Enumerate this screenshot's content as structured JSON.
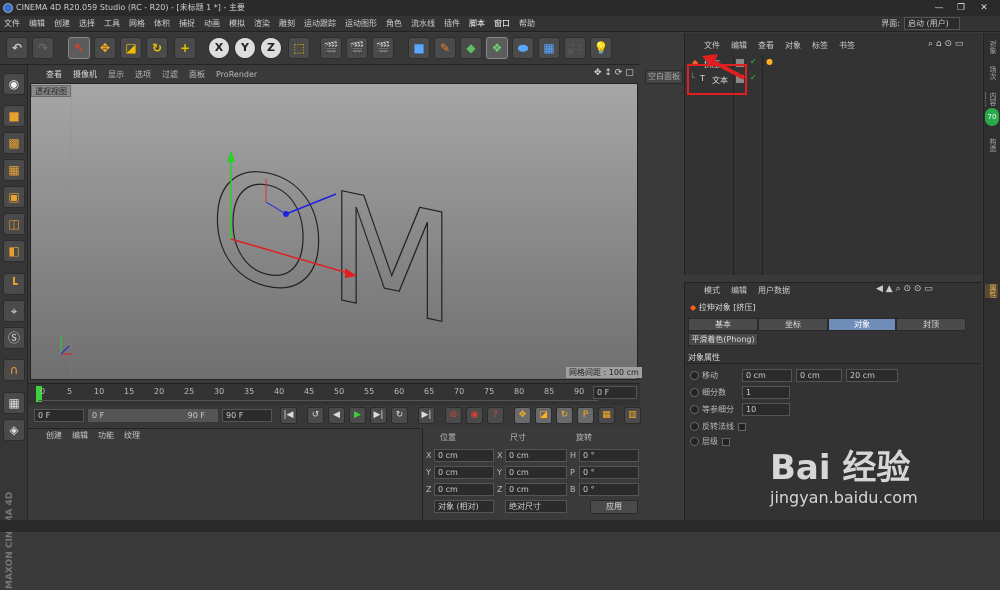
{
  "window": {
    "title": "CINEMA 4D R20.059 Studio (RC - R20) - [未标题 1 *] - 主要",
    "min": "—",
    "restore": "❐",
    "close": "✕"
  },
  "menu": [
    "文件",
    "编辑",
    "创建",
    "选择",
    "工具",
    "网格",
    "体积",
    "捕捉",
    "动画",
    "模拟",
    "渲染",
    "雕刻",
    "运动跟踪",
    "运动图形",
    "角色",
    "流水线",
    "插件",
    "脚本",
    "窗口",
    "帮助"
  ],
  "layout": {
    "label": "界面:",
    "value": "启动 (用户)"
  },
  "toolbar": {
    "undo": "↶",
    "redo": "↷",
    "select": "↖",
    "move": "✥",
    "scale": "◪",
    "rotate": "↻",
    "add": "+",
    "x": "X",
    "y": "Y",
    "z": "Z",
    "coord": "⬚"
  },
  "viewport": {
    "menu": [
      "查看",
      "摄像机",
      "显示",
      "选项",
      "过滤",
      "面板",
      "ProRender"
    ],
    "label": "透视视图",
    "grid": "网格间距 : 100 cm",
    "text3d": "OM",
    "empty_button": "空白面板"
  },
  "timeline": {
    "ticks": [
      "0",
      "5",
      "10",
      "15",
      "20",
      "25",
      "30",
      "35",
      "40",
      "45",
      "50",
      "55",
      "60",
      "65",
      "70",
      "75",
      "80",
      "85",
      "90"
    ],
    "end_field": "0 F"
  },
  "transport": {
    "start": "0 F",
    "range_start": "0 F",
    "range_end": "90 F",
    "end": "90 F"
  },
  "materials": {
    "menu": [
      "创建",
      "编辑",
      "功能",
      "纹理"
    ]
  },
  "coords": {
    "headers": [
      "位置",
      "尺寸",
      "旋转"
    ],
    "rows": [
      {
        "a": "X",
        "pos": "0 cm",
        "b": "X",
        "size": "0 cm",
        "c": "H",
        "rot": "0 °"
      },
      {
        "a": "Y",
        "pos": "0 cm",
        "b": "Y",
        "size": "0 cm",
        "c": "P",
        "rot": "0 °"
      },
      {
        "a": "Z",
        "pos": "0 cm",
        "b": "Z",
        "size": "0 cm",
        "c": "B",
        "rot": "0 °"
      }
    ],
    "mode": "对象 (相对)",
    "size_mode": "绝对尺寸",
    "apply": "应用"
  },
  "objects": {
    "menu": [
      "文件",
      "编辑",
      "查看",
      "对象",
      "标签",
      "书签"
    ],
    "items": [
      {
        "name": "挤压"
      },
      {
        "name": "文本"
      }
    ]
  },
  "attributes": {
    "menu": [
      "模式",
      "编辑",
      "用户数据"
    ],
    "title": "拉伸对象 [挤压]",
    "tabs": [
      "基本",
      "坐标",
      "对象",
      "封顶"
    ],
    "phong_tab": "平滑着色(Phong)",
    "section": "对象属性",
    "move_label": "移动",
    "move": [
      "0 cm",
      "0 cm",
      "20 cm"
    ],
    "subdiv_label": "细分数",
    "subdiv": "1",
    "iso_label": "等参细分",
    "iso": "10",
    "flip_label": "反转法线",
    "hier_label": "层级"
  },
  "right_tabs": [
    "对象",
    "场次",
    "内容浏览器",
    "构造"
  ],
  "right_badge": "70",
  "right_attr_tab": "属性",
  "brand": "MAXON CINEMA 4D",
  "watermark": {
    "logo": "Bai 经验",
    "url": "jingyan.baidu.com"
  }
}
